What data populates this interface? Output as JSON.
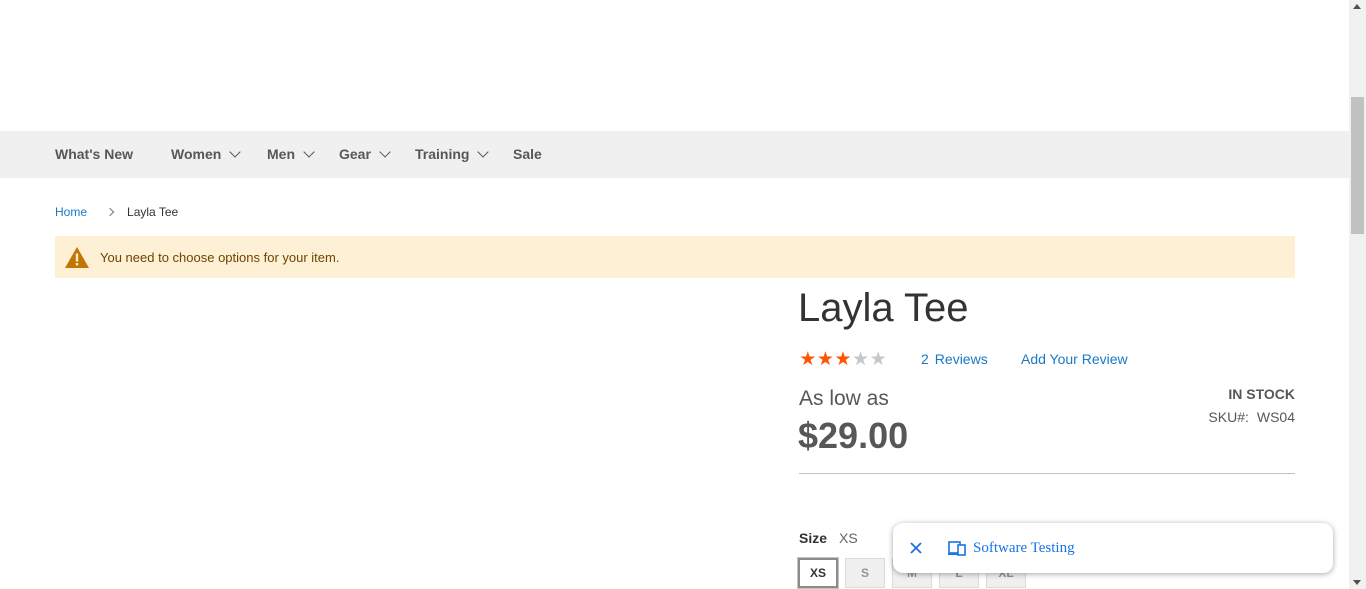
{
  "nav": {
    "items": [
      {
        "label": "What's New",
        "has_dropdown": false
      },
      {
        "label": "Women",
        "has_dropdown": true
      },
      {
        "label": "Men",
        "has_dropdown": true
      },
      {
        "label": "Gear",
        "has_dropdown": true
      },
      {
        "label": "Training",
        "has_dropdown": true
      },
      {
        "label": "Sale",
        "has_dropdown": false
      }
    ]
  },
  "breadcrumb": {
    "home": "Home",
    "current": "Layla Tee"
  },
  "alert": {
    "message": "You need to choose options for your item.",
    "icon": "warning-icon"
  },
  "product": {
    "name": "Layla Tee",
    "rating_stars": 3,
    "rating_max": 5,
    "reviews_count": "2",
    "reviews_label": "Reviews",
    "add_review_label": "Add Your Review",
    "price_label": "As low as",
    "price": "$29.00",
    "stock": "In stock",
    "sku_label": "SKU#:",
    "sku": "WS04",
    "size_label": "Size",
    "size_selected": "XS",
    "sizes": [
      "XS",
      "S",
      "M",
      "L",
      "XL"
    ]
  },
  "toast": {
    "text": "Software Testing",
    "close_icon": "close-icon",
    "device_icon": "devices-icon"
  },
  "colors": {
    "nav_bg": "#f0f0f0",
    "link": "#1979c3",
    "star_on": "#ff5501",
    "alert_bg": "#fdf0d5",
    "toast_link": "#1a73e8"
  }
}
